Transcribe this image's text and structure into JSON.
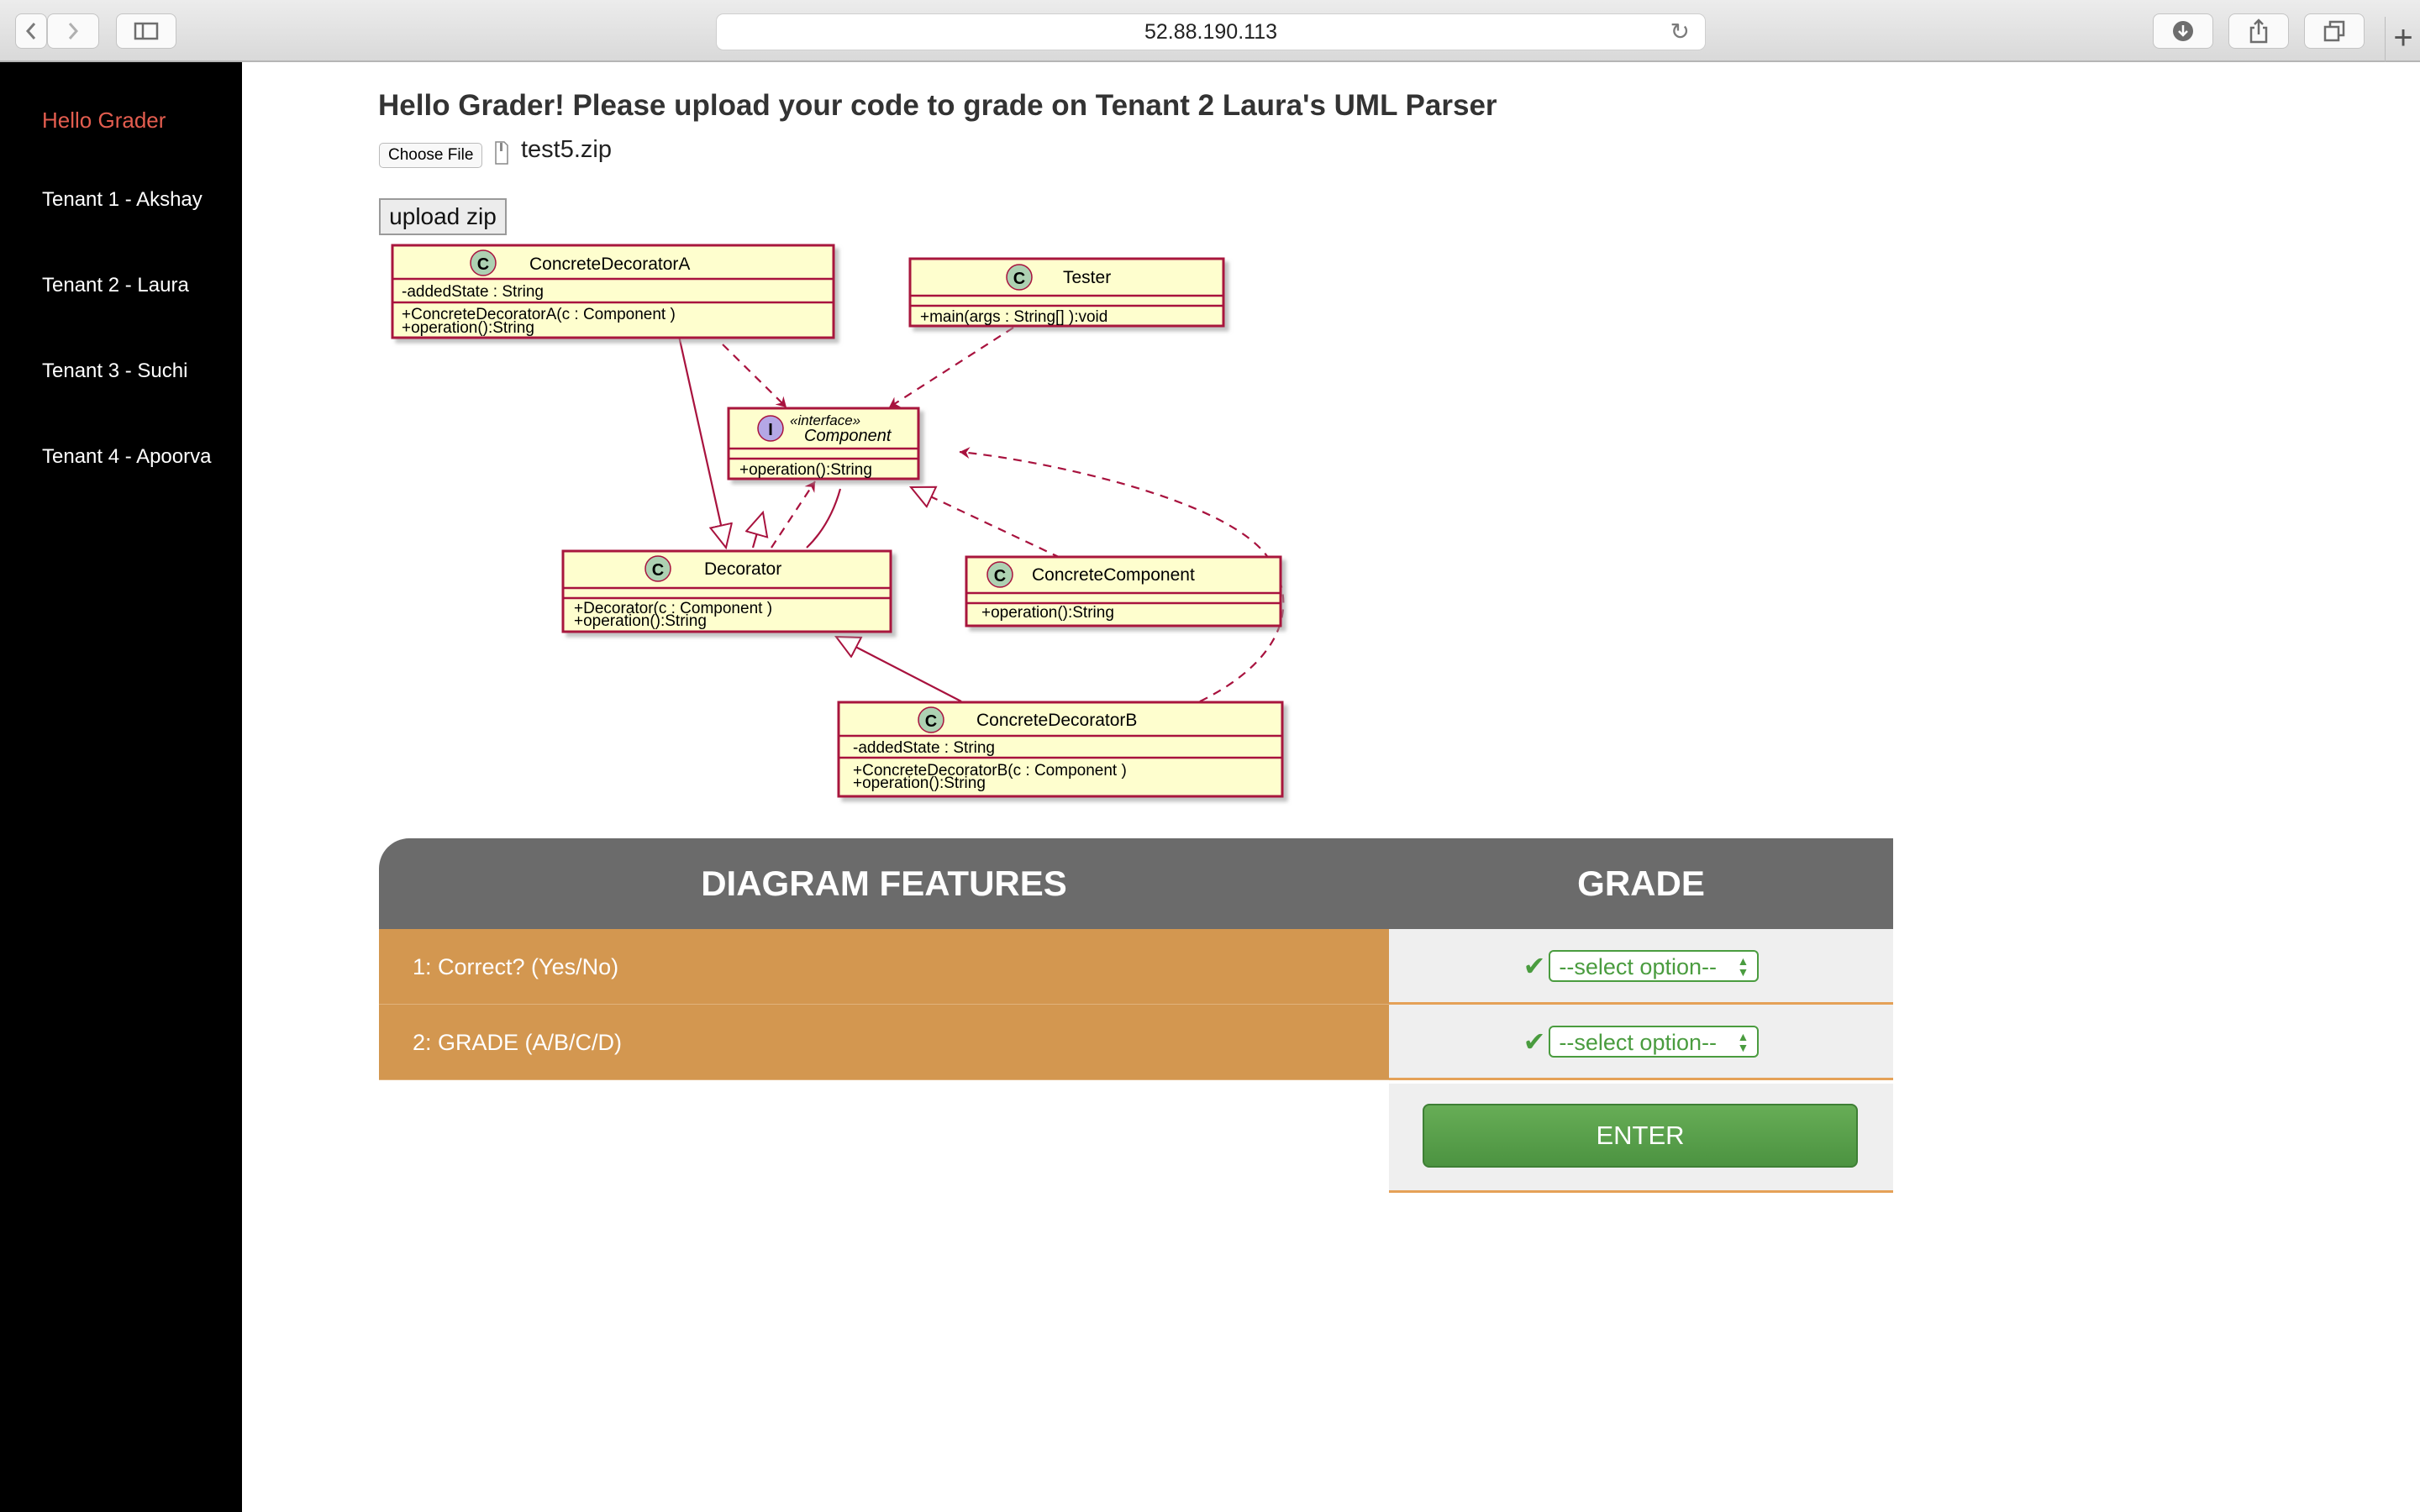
{
  "browser": {
    "url": "52.88.190.113"
  },
  "sidebar": {
    "items": [
      {
        "label": "Hello Grader"
      },
      {
        "label": "Tenant 1 - Akshay"
      },
      {
        "label": "Tenant 2 - Laura"
      },
      {
        "label": "Tenant 3 - Suchi"
      },
      {
        "label": "Tenant 4 - Apoorva"
      }
    ]
  },
  "main": {
    "title": "Hello Grader! Please upload your code to grade on Tenant 2 Laura's UML Parser",
    "choose_file_label": "Choose File",
    "file_name": "test5.zip",
    "upload_label": "upload zip"
  },
  "uml": {
    "classes": [
      {
        "name": "ConcreteDecoratorA",
        "fields": [
          "-addedState : String"
        ],
        "methods": [
          "+ConcreteDecoratorA(c : Component )",
          "+operation():String"
        ]
      },
      {
        "name": "Tester",
        "fields": [],
        "methods": [
          "+main(args : String[] ):void"
        ]
      },
      {
        "name": "Component",
        "stereotype": "«interface»",
        "fields": [],
        "methods": [
          "+operation():String"
        ]
      },
      {
        "name": "Decorator",
        "fields": [],
        "methods": [
          "+Decorator(c : Component )",
          "+operation():String"
        ]
      },
      {
        "name": "ConcreteComponent",
        "fields": [],
        "methods": [
          "+operation():String"
        ]
      },
      {
        "name": "ConcreteDecoratorB",
        "fields": [
          "-addedState : String"
        ],
        "methods": [
          "+ConcreteDecoratorB(c : Component )",
          "+operation():String"
        ]
      }
    ],
    "class_marker": "C",
    "interface_marker": "I"
  },
  "grading": {
    "headers": {
      "features": "DIAGRAM FEATURES",
      "grade": "GRADE"
    },
    "rows": [
      {
        "label": "1: Correct? (Yes/No)",
        "selected": "--select option--"
      },
      {
        "label": "2: GRADE (A/B/C/D)",
        "selected": "--select option--"
      }
    ],
    "enter_label": "ENTER"
  },
  "colors": {
    "sidebar_bg": "#000000",
    "active_nav": "#e35d4f",
    "header_bg": "#6b6b6b",
    "row_label_bg": "#d39750",
    "accent_green": "#4a9c3f",
    "uml_border": "#a8123e",
    "uml_fill": "#fefece"
  }
}
